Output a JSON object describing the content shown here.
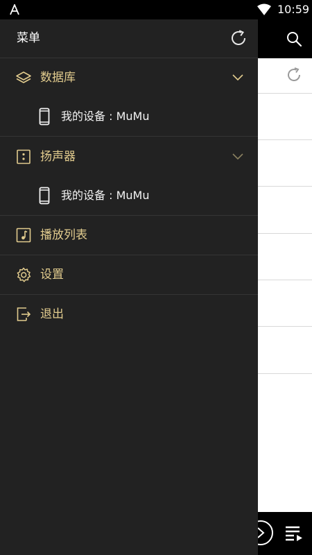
{
  "status_bar": {
    "time": "10:59",
    "icons": [
      "app-notification-icon",
      "wifi-icon"
    ]
  },
  "drawer": {
    "title": "菜单",
    "header_icon": "refresh-icon",
    "accent_color": "#e2cc8e",
    "background_color": "#222222",
    "sections": [
      {
        "label": "数据库",
        "icon": "layers-icon",
        "expanded": true,
        "devices": [
          {
            "label": "我的设备 : MuMu",
            "icon": "phone-icon"
          }
        ]
      },
      {
        "label": "扬声器",
        "icon": "speaker-icon",
        "expanded": true,
        "devices": [
          {
            "label": "我的设备 : MuMu",
            "icon": "phone-icon"
          }
        ]
      }
    ],
    "items": [
      {
        "label": "播放列表",
        "icon": "playlist-icon"
      },
      {
        "label": "设置",
        "icon": "gear-icon"
      },
      {
        "label": "退出",
        "icon": "exit-icon"
      }
    ]
  },
  "background_app": {
    "toolbar_icons": [
      "search-icon"
    ],
    "content_icons": [
      "refresh-icon"
    ],
    "bottom_bar_icons": [
      "play-icon",
      "queue-icon"
    ]
  }
}
